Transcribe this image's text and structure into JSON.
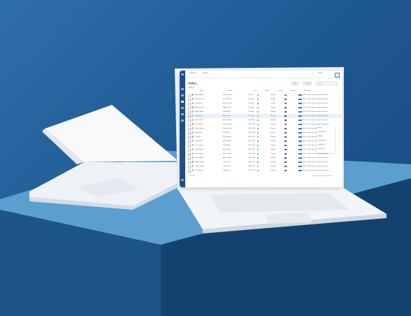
{
  "topbar": {
    "crumb_back": "‹ Data set",
    "crumb_current": "› Visitors",
    "share_label": "Share",
    "bell_icon": "bell-icon",
    "settings_icon": "gear-icon"
  },
  "page": {
    "title": "Visitors",
    "subtitle": "Updated just now",
    "add_label": "+ Add row",
    "filter_label": "Filters",
    "columns_label": "Columns",
    "search_placeholder": "Search"
  },
  "table": {
    "headers": [
      "Name",
      "Agent",
      "Date",
      "Status",
      "Country",
      "Location",
      "Messages"
    ],
    "rows": [
      {
        "name": "Mark Ellington",
        "agent": "Morris Howard",
        "date": "1 min ago",
        "country": "CA",
        "avatar": "#f28b82"
      },
      {
        "name": "Robert Dunlap",
        "agent": "Tina Wilkinson",
        "date": "1 min ago",
        "country": "US",
        "avatar": "#f6ae6b"
      },
      {
        "name": "Lucy Morton",
        "agent": "Monica Salinas",
        "date": "1 min ago",
        "country": "CA",
        "avatar": "#8ac6f2"
      },
      {
        "name": "Barbara Jonas",
        "agent": "Valentin Lara",
        "date": "1 min ago",
        "country": "US",
        "avatar": "#f28b82"
      },
      {
        "name": "Marcus Bolton",
        "agent": "Sandra Mills",
        "date": "1 min ago",
        "country": "US",
        "avatar": "#9ad28d"
      },
      {
        "name": "Oswald Kent",
        "agent": "Dennis Shaw",
        "date": "1 min ago",
        "country": "UK",
        "avatar": "#8ac6f2"
      },
      {
        "name": "Martin Cooke",
        "agent": "Morris Howard",
        "date": "2 Mar 2019",
        "country": "US",
        "avatar": "#f6ae6b"
      },
      {
        "name": "Sofia Stanton",
        "agent": "Monica Salinas",
        "date": "2 Mar 2019",
        "country": "CA",
        "avatar": "#f28b82"
      },
      {
        "name": "Hank Lockman",
        "agent": "Robert Wesley",
        "date": "2 Mar 2019",
        "country": "US",
        "avatar": "#9ad28d"
      },
      {
        "name": "Lori Watson",
        "agent": "Ulrich Klein",
        "date": "2 Mar 2019",
        "country": "US",
        "avatar": "#8ac6f2"
      },
      {
        "name": "Larry Bliss",
        "agent": "Rosa Romero",
        "date": "2 Mar 2019",
        "country": "US",
        "avatar": "#f28b82"
      },
      {
        "name": "Lorena Flores",
        "agent": "Rosa Romero",
        "date": "2 Mar 2019",
        "country": "US",
        "avatar": "#9ad28d"
      },
      {
        "name": "Loren Thorpe",
        "agent": "Sandra Mills",
        "date": "2 Mar 2019",
        "country": "US",
        "avatar": "#8ac6f2"
      },
      {
        "name": "Lynn Romano",
        "agent": "Dennis Shaw",
        "date": "2 Mar 2019",
        "country": "US",
        "avatar": "#f6ae6b"
      },
      {
        "name": "Jimmy Hardin",
        "agent": "Morris Howard",
        "date": "2 Mar 2019",
        "country": "US",
        "avatar": "#9ad28d"
      },
      {
        "name": "Justin Hopkins",
        "agent": "Monica Salinas",
        "date": "2 Mar 2019",
        "country": "UK",
        "avatar": "#8ac6f2"
      },
      {
        "name": "Robert Mendez",
        "agent": "Camila Jean",
        "date": "2 Mar 2019",
        "country": "US",
        "avatar": "#f28b82"
      },
      {
        "name": "Marcus Morgan",
        "agent": "Camila Jean",
        "date": "2 Mar 2019",
        "country": "US",
        "avatar": "#9ad28d"
      },
      {
        "name": "Louis Hansen",
        "agent": "Camila Jean",
        "date": "2 Mar 2019",
        "country": "US",
        "avatar": "#8ac6f2"
      }
    ],
    "message_preview": "Hello! Can you help me with my order please?",
    "status_value": "Online",
    "location_value": "Chicago"
  },
  "context_menu": {
    "items": [
      "Reply",
      "Go to Profile",
      "Add tag",
      "Download chat",
      "Archive chat",
      "Delete chat"
    ]
  },
  "pager": {
    "left": "1 selected",
    "right": "Rows per page: 20  1–20 of 230  ‹ ›"
  },
  "colors": {
    "sidebar": "#1f4f86",
    "accent": "#2f6fd1",
    "background": "#1f5a93"
  }
}
